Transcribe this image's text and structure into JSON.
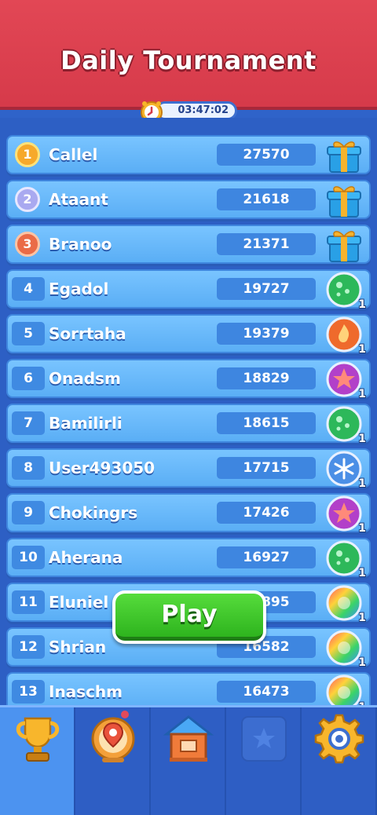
{
  "header": {
    "title": "Daily Tournament",
    "timer": "03:47:02"
  },
  "leaderboard": [
    {
      "rank": "1",
      "name": "Callel",
      "score": "27570",
      "medal": "gold",
      "reward": "gift-icon",
      "reward_count": ""
    },
    {
      "rank": "2",
      "name": "Ataant",
      "score": "21618",
      "medal": "silver",
      "reward": "gift-icon",
      "reward_count": ""
    },
    {
      "rank": "3",
      "name": "Branoo",
      "score": "21371",
      "medal": "bronze",
      "reward": "gift-icon",
      "reward_count": ""
    },
    {
      "rank": "4",
      "name": "Egadol",
      "score": "19727",
      "medal": "",
      "reward": "green-ball-icon",
      "reward_count": "1"
    },
    {
      "rank": "5",
      "name": "Sorrtaha",
      "score": "19379",
      "medal": "",
      "reward": "fire-ball-icon",
      "reward_count": "1"
    },
    {
      "rank": "6",
      "name": "Onadsm",
      "score": "18829",
      "medal": "",
      "reward": "star-ball-icon",
      "reward_count": "1"
    },
    {
      "rank": "7",
      "name": "Bamilirli",
      "score": "18615",
      "medal": "",
      "reward": "green-ball-icon",
      "reward_count": "1"
    },
    {
      "rank": "8",
      "name": "User493050",
      "score": "17715",
      "medal": "",
      "reward": "snowflake-ball-icon",
      "reward_count": "1"
    },
    {
      "rank": "9",
      "name": "Chokingrs",
      "score": "17426",
      "medal": "",
      "reward": "star-ball-icon",
      "reward_count": "1"
    },
    {
      "rank": "10",
      "name": "Aherana",
      "score": "16927",
      "medal": "",
      "reward": "green-ball-icon",
      "reward_count": "1"
    },
    {
      "rank": "11",
      "name": "Eluniel",
      "score": "16895",
      "medal": "",
      "reward": "rainbow-ball-icon",
      "reward_count": "1"
    },
    {
      "rank": "12",
      "name": "Shrian",
      "score": "16582",
      "medal": "",
      "reward": "rainbow-ball-icon",
      "reward_count": "1"
    },
    {
      "rank": "13",
      "name": "Inaschm",
      "score": "16473",
      "medal": "",
      "reward": "rainbow-ball-icon",
      "reward_count": "1"
    }
  ],
  "play_button": {
    "label": "Play"
  },
  "bottom_nav": [
    {
      "id": "trophy",
      "icon": "trophy-icon",
      "active": true
    },
    {
      "id": "map",
      "icon": "map-pin-icon",
      "active": false
    },
    {
      "id": "home",
      "icon": "house-icon",
      "active": false
    },
    {
      "id": "collection",
      "icon": "locked-star-icon",
      "active": false
    },
    {
      "id": "settings",
      "icon": "gear-icon",
      "active": false
    }
  ],
  "colors": {
    "header_red": "#e24755",
    "row_blue": "#79c4ff",
    "play_green": "#3fc42a",
    "gold": "#f6a92b"
  }
}
